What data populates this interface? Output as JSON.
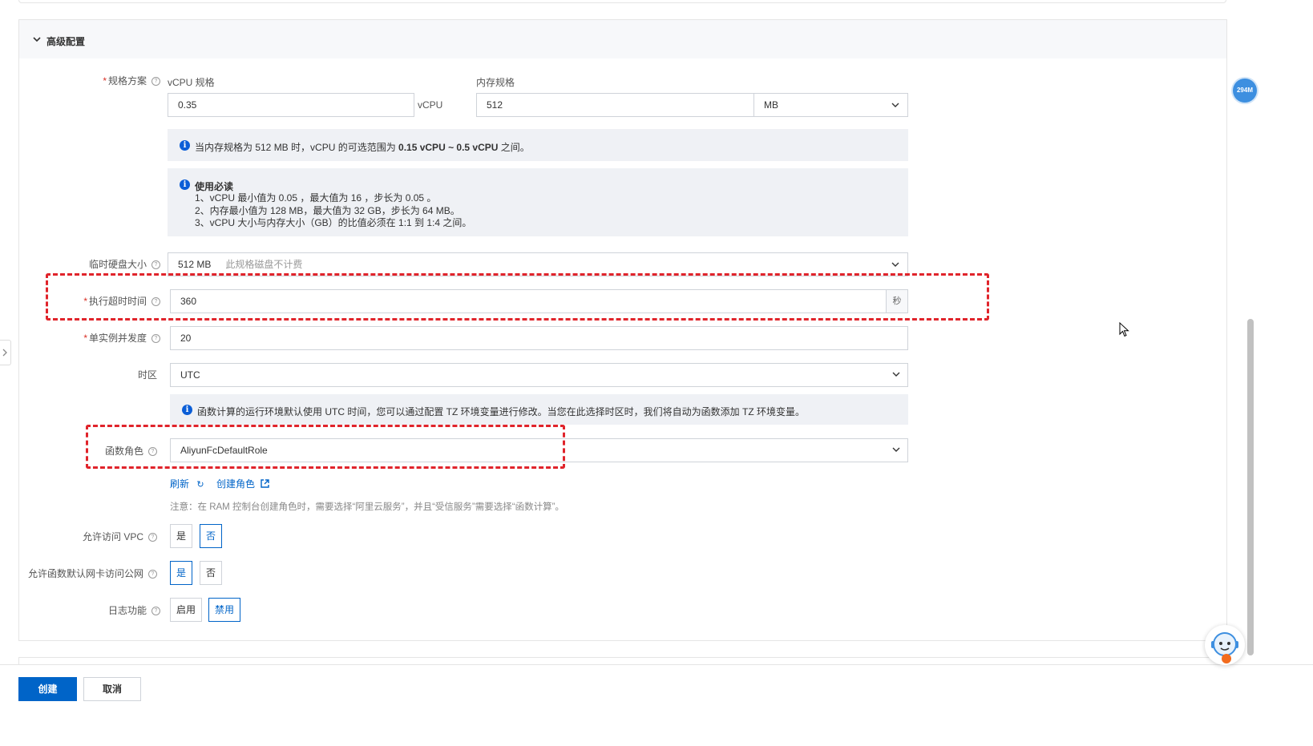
{
  "section": {
    "title": "高级配置"
  },
  "spec": {
    "label": "规格方案",
    "vcpu_label": "vCPU 规格",
    "vcpu_value": "0.35",
    "vcpu_unit": "vCPU",
    "memory_label": "内存规格",
    "memory_value": "512",
    "memory_unit": "MB",
    "range_notice_prefix": "当内存规格为 512 MB 时，vCPU 的可选范围为 ",
    "range_notice_bold": "0.15 vCPU ~ 0.5 vCPU",
    "range_notice_suffix": " 之间。",
    "rules_title": "使用必读",
    "rules": [
      "1、vCPU 最小值为 0.05 ，最大值为 16 ，步长为 0.05 。",
      "2、内存最小值为 128 MB，最大值为 32 GB，步长为 64 MB。",
      "3、vCPU 大小与内存大小（GB）的比值必须在 1:1 到 1:4 之间。"
    ]
  },
  "disk": {
    "label": "临时硬盘大小",
    "value": "512 MB",
    "hint": "此规格磁盘不计费"
  },
  "timeout": {
    "label": "执行超时时间",
    "value": "360",
    "unit": "秒"
  },
  "concurrency": {
    "label": "单实例并发度",
    "value": "20"
  },
  "timezone": {
    "label": "时区",
    "value": "UTC",
    "notice": "函数计算的运行环境默认使用 UTC 时间，您可以通过配置 TZ 环境变量进行修改。当您在此选择时区时，我们将自动为函数添加 TZ 环境变量。"
  },
  "role": {
    "label": "函数角色",
    "value": "AliyunFcDefaultRole",
    "refresh": "刷新",
    "create": "创建角色",
    "note": "注意：在 RAM 控制台创建角色时，需要选择“阿里云服务”，并且“受信服务”需要选择“函数计算”。"
  },
  "vpc": {
    "label": "允许访问 VPC",
    "yes": "是",
    "no": "否",
    "selected": "否"
  },
  "internet": {
    "label": "允许函数默认网卡访问公网",
    "yes": "是",
    "no": "否",
    "selected": "是"
  },
  "logging": {
    "label": "日志功能",
    "enable": "启用",
    "disable": "禁用",
    "selected": "禁用"
  },
  "footer": {
    "create": "创建",
    "cancel": "取消"
  },
  "float_badge": "294M",
  "colors": {
    "primary": "#0064c8",
    "annotation": "#e0242b",
    "required": "#d93026"
  }
}
